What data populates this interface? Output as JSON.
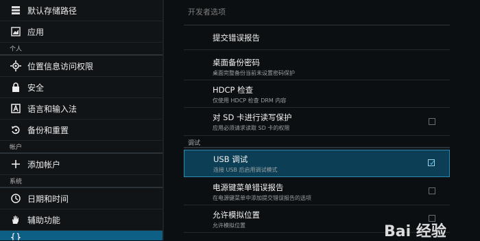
{
  "sidebar": {
    "items": [
      {
        "label": "默认存储路径",
        "icon": "storage-icon",
        "type": "item"
      },
      {
        "label": "应用",
        "icon": "apps-icon",
        "type": "item"
      },
      {
        "label": "个人",
        "type": "header"
      },
      {
        "label": "位置信息访问权限",
        "icon": "location-icon",
        "type": "item"
      },
      {
        "label": "安全",
        "icon": "lock-icon",
        "type": "item"
      },
      {
        "label": "语言和输入法",
        "icon": "language-icon",
        "type": "item"
      },
      {
        "label": "备份和重置",
        "icon": "backup-icon",
        "type": "item"
      },
      {
        "label": "帐户",
        "type": "header"
      },
      {
        "label": "添加帐户",
        "icon": "add-icon",
        "type": "item"
      },
      {
        "label": "系统",
        "type": "header"
      },
      {
        "label": "日期和时间",
        "icon": "clock-icon",
        "type": "item"
      },
      {
        "label": "辅助功能",
        "icon": "hand-icon",
        "type": "item"
      }
    ]
  },
  "main": {
    "dev_options_label": "开发者选项",
    "section_debug": "调试",
    "rows": [
      {
        "title": "提交错误报告",
        "sub": "",
        "checkbox": false,
        "checked": false
      },
      {
        "title": "桌面备份密码",
        "sub": "桌面完整备份当前未设置密码保护",
        "checkbox": false,
        "checked": false
      },
      {
        "title": "HDCP 检查",
        "sub": "仅使用 HDCP 检查 DRM 内容",
        "checkbox": false,
        "checked": false
      },
      {
        "title": "对 SD 卡进行读写保护",
        "sub": "应用必须请求读取 SD 卡的权限",
        "checkbox": true,
        "checked": false
      },
      {
        "title": "USB 调试",
        "sub": "连接 USB 后启用调试模式",
        "checkbox": true,
        "checked": true
      },
      {
        "title": "电源键菜单错误报告",
        "sub": "在电源键菜单中添加提交错误报告的选项",
        "checkbox": true,
        "checked": false
      },
      {
        "title": "允许模拟位置",
        "sub": "允许模拟位置",
        "checkbox": true,
        "checked": false
      }
    ]
  },
  "watermark": {
    "text": "Bai 经验"
  },
  "colors": {
    "accent": "#0e5f86",
    "selected_row": "#0c3f56",
    "check_tick": "#4fb7e6"
  }
}
